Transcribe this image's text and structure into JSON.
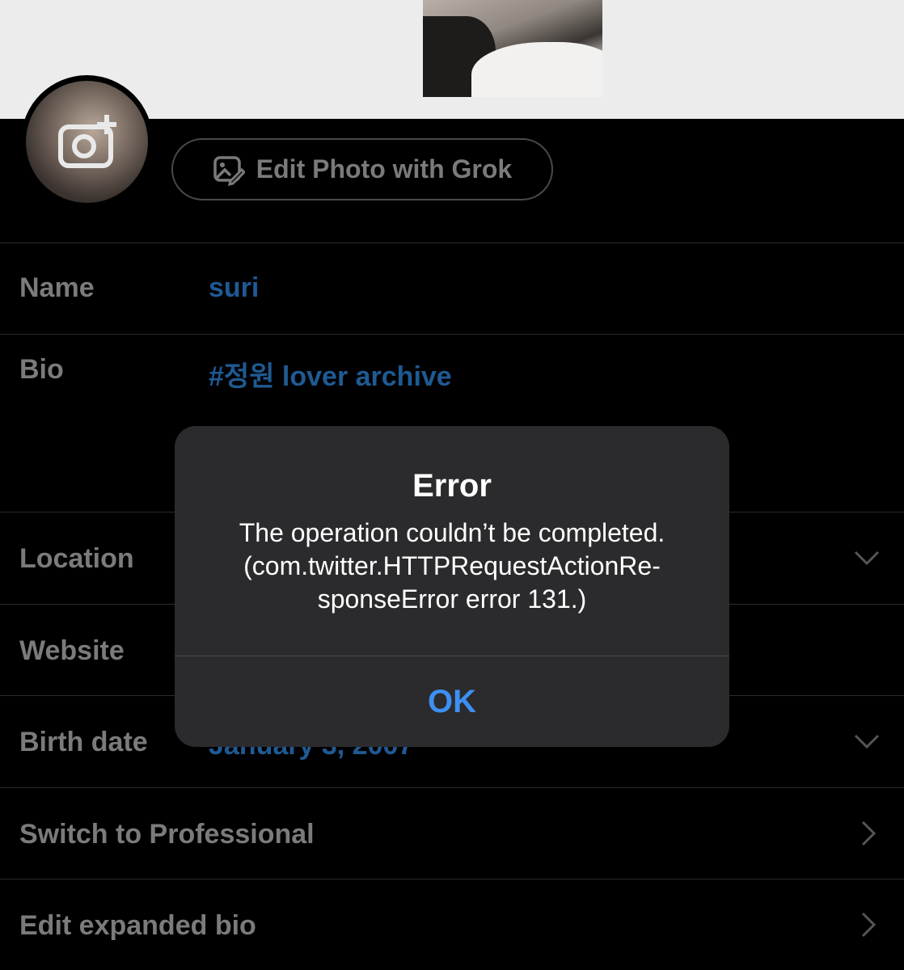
{
  "header": {
    "edit_photo_label": "Edit Photo with Grok"
  },
  "fields": {
    "name": {
      "label": "Name",
      "value": "suri"
    },
    "bio": {
      "label": "Bio",
      "value": "#정원 lover archive"
    },
    "location": {
      "label": "Location"
    },
    "website": {
      "label": "Website"
    },
    "birth_date": {
      "label": "Birth date",
      "value": "January 3, 2007"
    },
    "switch_professional": {
      "label": "Switch to Professional"
    },
    "expanded_bio": {
      "label": "Edit expanded bio"
    }
  },
  "dialog": {
    "title": "Error",
    "message_line1": "The operation couldn’t be completed.",
    "message_line2": "(com.twitter.HTTPRequestActionRe-",
    "message_line3": "sponseError error 131.)",
    "ok_label": "OK"
  },
  "colors": {
    "accent": "#3d8ff2",
    "value_text": "#1f5a93",
    "dialog_bg": "#2b2b2d"
  },
  "icons": [
    "camera-plus-icon",
    "image-edit-icon",
    "chevron-down-icon",
    "chevron-right-icon"
  ]
}
